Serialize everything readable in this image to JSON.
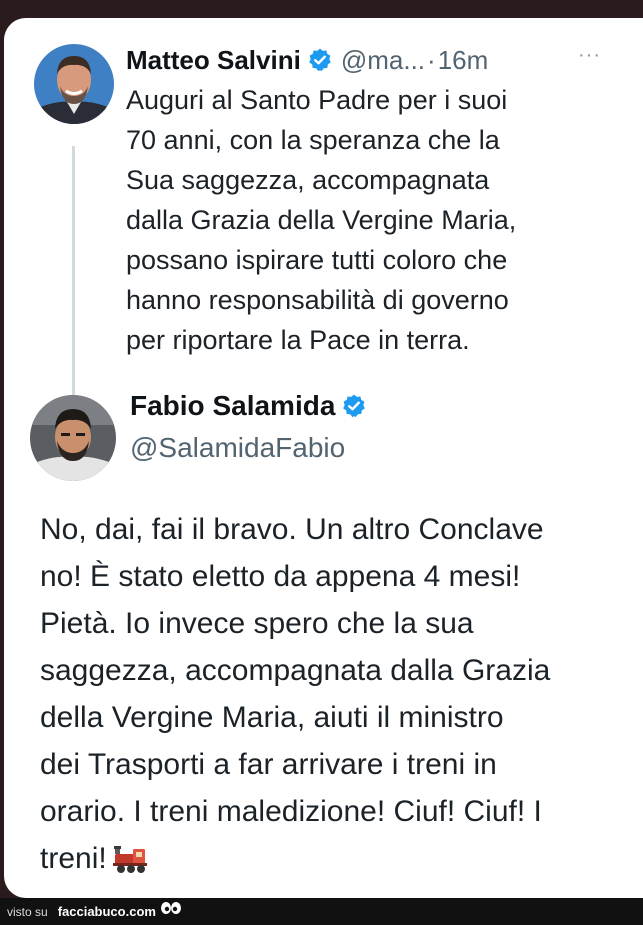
{
  "tweet1": {
    "name": "Matteo Salvini",
    "handle": "@ma...",
    "separator": "·",
    "time": "16m",
    "more": "···",
    "lines": [
      "Auguri al Santo Padre per i suoi",
      "70 anni, con la speranza che la",
      "Sua saggezza, accompagnata",
      "dalla Grazia della Vergine Maria,",
      "possano ispirare tutti coloro che",
      "hanno responsabilità di governo",
      "per riportare la Pace in terra."
    ]
  },
  "tweet2": {
    "name": "Fabio Salamida",
    "handle": "@SalamidaFabio",
    "lines": [
      "No, dai, fai il bravo. Un altro Conclave",
      "no! È stato eletto da appena 4 mesi!",
      "Pietà. Io invece spero che la sua",
      "saggezza, accompagnata dalla Grazia",
      "della Vergine Maria, aiuti il ministro",
      "dei Trasporti a far arrivare i treni in",
      "orario. I treni maledizione! Ciuf! Ciuf! I",
      "treni!"
    ],
    "emoji": "locomotive-emoji"
  },
  "footer": {
    "label": "visto su",
    "brand": "facciabuco.com",
    "icon": "eyes-logo-icon"
  },
  "colors": {
    "verified": "#1d9bf0",
    "background": "#2a1c1c",
    "card": "#ffffff",
    "text": "#0f1419",
    "muted": "#536471"
  }
}
